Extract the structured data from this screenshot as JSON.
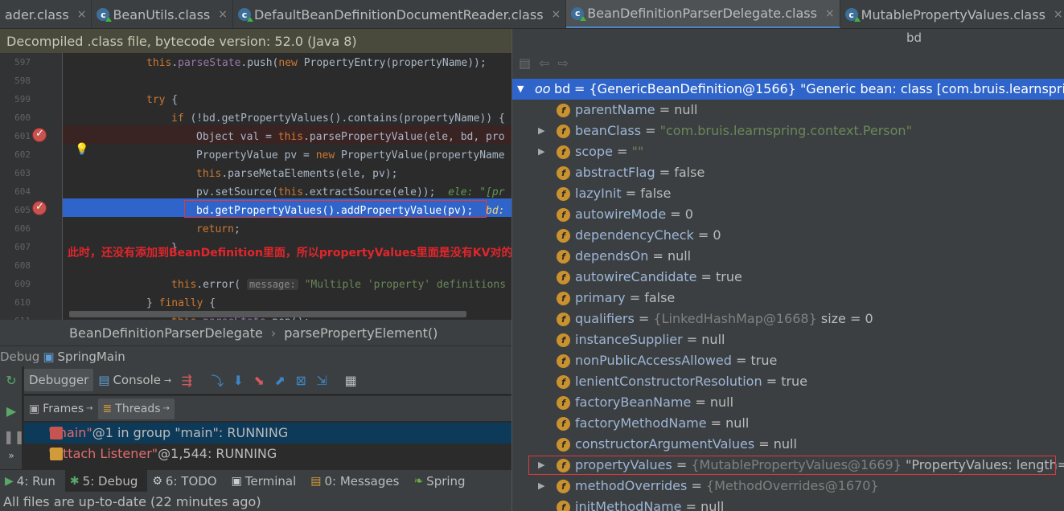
{
  "tabs": [
    {
      "label": "ader.class",
      "active": false,
      "has_icon": false
    },
    {
      "label": "BeanUtils.class",
      "active": false,
      "has_icon": true
    },
    {
      "label": "DefaultBeanDefinitionDocumentReader.class",
      "active": false,
      "has_icon": true
    },
    {
      "label": "BeanDefinitionParserDelegate.class",
      "active": true,
      "has_icon": true
    },
    {
      "label": "MutablePropertyValues.class",
      "active": false,
      "has_icon": true
    }
  ],
  "tab_overflow": "▾≡6",
  "banner": "Decompiled .class file, bytecode version: 52.0 (Java 8)",
  "code": {
    "line_numbers": [
      "597",
      "598",
      "599",
      "600",
      "601",
      "602",
      "603",
      "604",
      "605",
      "606",
      "607",
      "608",
      "609",
      "610",
      "611"
    ],
    "lines": [
      "this.parseState.push(new PropertyEntry(propertyName));",
      "",
      "try {",
      "    if (!bd.getPropertyValues().contains(propertyName)) {",
      "        Object val = this.parsePropertyValue(ele, bd, pro",
      "        PropertyValue pv = new PropertyValue(propertyName",
      "        this.parseMetaElements(ele, pv);",
      "        pv.setSource(this.extractSource(ele));",
      "        bd.getPropertyValues().addPropertyValue(pv);",
      "        return;",
      "    }",
      "",
      "    this.error(",
      "} finally {",
      "    this.parseState.pop();"
    ],
    "inline_comment_604": "ele: \"[pr",
    "inline_hint_605": "bd:",
    "param_hint_609": "message:",
    "string_609": "\"Multiple 'property' definitions",
    "annotation": "此时，还没有添加到BeanDefinition里面，所以propertyValues里面是没有KV对的。"
  },
  "breadcrumb": [
    "BeanDefinitionParserDelegate",
    "parsePropertyElement()"
  ],
  "debug": {
    "title": "Debug",
    "config": "SpringMain",
    "tabs": [
      "Debugger",
      "Console"
    ],
    "frames_tabs": [
      "Frames",
      "Threads"
    ],
    "threads": [
      {
        "name": "\"main\"",
        "rest": "@1 in group \"main\": RUNNING",
        "selected": true
      },
      {
        "name": "\"Attach Listener\"",
        "rest": "@1,544: RUNNING",
        "selected": false
      }
    ]
  },
  "toolwindows": [
    {
      "label": "4: Run",
      "icon": "play-icon"
    },
    {
      "label": "5: Debug",
      "icon": "bug-icon",
      "selected": true
    },
    {
      "label": "6: TODO",
      "icon": "todo-icon"
    },
    {
      "label": "Terminal",
      "icon": "terminal-icon"
    },
    {
      "label": "0: Messages",
      "icon": "messages-icon"
    },
    {
      "label": "Spring",
      "icon": "spring-icon"
    }
  ],
  "status": "All files are up-to-date (22 minutes ago)",
  "popup": {
    "title": "bd",
    "root": {
      "name": "bd",
      "value": "= {GenericBeanDefinition@1566} \"Generic bean: class [com.bruis.learnspring.con"
    },
    "fields": [
      {
        "name": "parentName",
        "eq": " = ",
        "val": "null",
        "kind": "white",
        "expand": false
      },
      {
        "name": "beanClass",
        "eq": " = ",
        "val": "\"com.bruis.learnspring.context.Person\"",
        "kind": "str",
        "expand": true
      },
      {
        "name": "scope",
        "eq": " = ",
        "val": "\"\"",
        "kind": "str",
        "expand": true
      },
      {
        "name": "abstractFlag",
        "eq": " = ",
        "val": "false",
        "kind": "white",
        "expand": false
      },
      {
        "name": "lazyInit",
        "eq": " = ",
        "val": "false",
        "kind": "white",
        "expand": false
      },
      {
        "name": "autowireMode",
        "eq": " = ",
        "val": "0",
        "kind": "white",
        "expand": false
      },
      {
        "name": "dependencyCheck",
        "eq": " = ",
        "val": "0",
        "kind": "white",
        "expand": false
      },
      {
        "name": "dependsOn",
        "eq": " = ",
        "val": "null",
        "kind": "white",
        "expand": false
      },
      {
        "name": "autowireCandidate",
        "eq": " = ",
        "val": "true",
        "kind": "white",
        "expand": false
      },
      {
        "name": "primary",
        "eq": " = ",
        "val": "false",
        "kind": "white",
        "expand": false
      },
      {
        "name": "qualifiers",
        "eq": " = ",
        "val": "{LinkedHashMap@1668}",
        "extra": "  size = 0",
        "kind": "gray",
        "expand": false
      },
      {
        "name": "instanceSupplier",
        "eq": " = ",
        "val": "null",
        "kind": "white",
        "expand": false
      },
      {
        "name": "nonPublicAccessAllowed",
        "eq": " = ",
        "val": "true",
        "kind": "white",
        "expand": false
      },
      {
        "name": "lenientConstructorResolution",
        "eq": " = ",
        "val": "true",
        "kind": "white",
        "expand": false
      },
      {
        "name": "factoryBeanName",
        "eq": " = ",
        "val": "null",
        "kind": "white",
        "expand": false
      },
      {
        "name": "factoryMethodName",
        "eq": " = ",
        "val": "null",
        "kind": "white",
        "expand": false
      },
      {
        "name": "constructorArgumentValues",
        "eq": " = ",
        "val": "null",
        "kind": "white",
        "expand": false
      },
      {
        "name": "propertyValues",
        "eq": " = ",
        "val": "{MutablePropertyValues@1669}",
        "extra": " \"PropertyValues: length=0\"",
        "kind": "gray",
        "expand": true
      },
      {
        "name": "methodOverrides",
        "eq": " = ",
        "val": "{MethodOverrides@1670}",
        "kind": "gray",
        "expand": true
      },
      {
        "name": "initMethodName",
        "eq": " = ",
        "val": "null",
        "kind": "white",
        "expand": false
      }
    ]
  },
  "colors": {
    "accent": "#2f65ca",
    "breakpoint": "#c75450",
    "highlight_box": "#e0393e",
    "annotation": "#e0262c"
  }
}
